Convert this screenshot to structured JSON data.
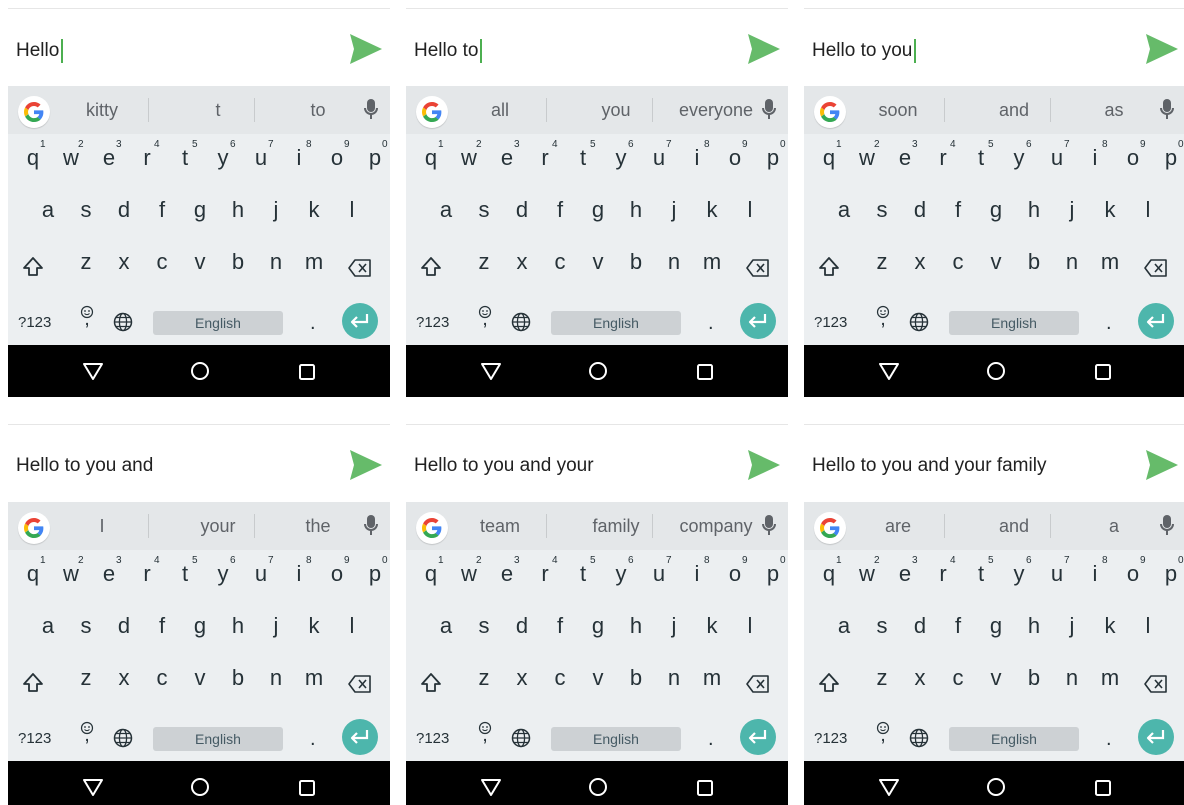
{
  "colors": {
    "accent": "#4caf50",
    "send": "#66bb6a",
    "keyboard_bg": "#eceff1",
    "suggestion_bg": "#e4e7e9",
    "enter_key": "#4db6ac",
    "nav_bar": "#000000"
  },
  "icons": [
    "send-icon",
    "google-icon",
    "mic-icon",
    "shift-icon",
    "backspace-icon",
    "emoji-icon",
    "globe-icon",
    "enter-icon",
    "nav-back-icon",
    "nav-home-icon",
    "nav-recents-icon"
  ],
  "keyboard": {
    "row1": [
      "q",
      "w",
      "e",
      "r",
      "t",
      "y",
      "u",
      "i",
      "o",
      "p"
    ],
    "row1_hints": [
      "1",
      "2",
      "3",
      "4",
      "5",
      "6",
      "7",
      "8",
      "9",
      "0"
    ],
    "row2": [
      "a",
      "s",
      "d",
      "f",
      "g",
      "h",
      "j",
      "k",
      "l"
    ],
    "row3": [
      "z",
      "x",
      "c",
      "v",
      "b",
      "n",
      "m"
    ],
    "symbols_label": "?123",
    "comma": ",",
    "space_label": "English",
    "period": "."
  },
  "panels": [
    {
      "message": "Hello",
      "has_cursor": true,
      "suggestions": [
        "kitty",
        "t",
        "to"
      ]
    },
    {
      "message": "Hello to",
      "has_cursor": true,
      "suggestions": [
        "all",
        "you",
        "everyone"
      ]
    },
    {
      "message": "Hello to you",
      "has_cursor": true,
      "suggestions": [
        "soon",
        "and",
        "as"
      ]
    },
    {
      "message": "Hello to you and",
      "has_cursor": false,
      "suggestions": [
        "I",
        "your",
        "the"
      ]
    },
    {
      "message": "Hello to you and your",
      "has_cursor": false,
      "suggestions": [
        "team",
        "family",
        "company"
      ]
    },
    {
      "message": "Hello to you and your family",
      "has_cursor": false,
      "suggestions": [
        "are",
        "and",
        "a"
      ]
    }
  ]
}
